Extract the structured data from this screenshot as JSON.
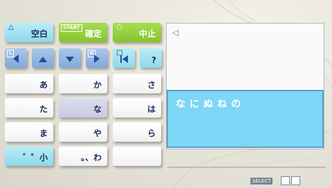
{
  "keyboard": {
    "row1": {
      "triangle_symbol": "△",
      "space_label": "空白",
      "start_tag": "START",
      "confirm_label": "確定",
      "circle_symbol": "○",
      "cancel_label": "中止"
    },
    "row2": {
      "l_tag": "L",
      "r_tag": "R",
      "square_symbol": "□",
      "help_label": "?"
    },
    "kana": [
      "あ",
      "か",
      "さ",
      "た",
      "な",
      "は",
      "ま",
      "や",
      "ら"
    ],
    "bottom": {
      "dakuten_label": "゛゜小",
      "punct_label": "。、わ",
      "blank_label": ""
    }
  },
  "panel": {
    "caret_symbol": "◁",
    "input_text": "なにぬねの"
  },
  "footer": {
    "select_label": "SELECT"
  },
  "colors": {
    "accent_cyan": "#7fd6f6",
    "confirm_green": "#86c42c",
    "nav_blue": "#84a8d8",
    "text_navy": "#1a2e55"
  }
}
